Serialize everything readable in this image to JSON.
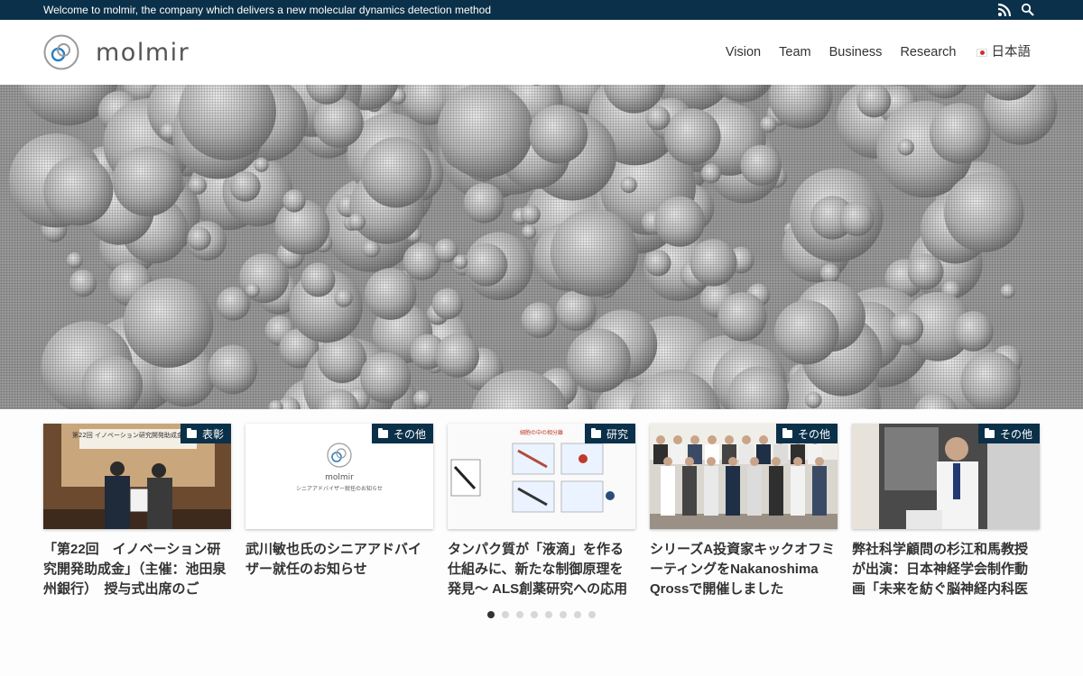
{
  "topbar": {
    "welcome": "Welcome to molmir, the company which delivers a new molecular dynamics detection method",
    "icons": [
      "rss-icon",
      "search-icon"
    ]
  },
  "header": {
    "logo_text": "molmir",
    "nav": [
      "Vision",
      "Team",
      "Business",
      "Research"
    ],
    "language": "日本語"
  },
  "colors": {
    "topbar_bg": "#0b3049",
    "category_badge": "#0b3049",
    "logo_blue": "#2a7fc4"
  },
  "cards": [
    {
      "category": "表彰",
      "title": "「第22回　イノベーション研究開発助成金」（主催：池田泉州銀行）　授与式出席のご",
      "thumb_text": "第22回 イノベーション研究開発助成金 授与式"
    },
    {
      "category": "その他",
      "title": "武川敏也氏のシニアアドバイザー就任のお知らせ",
      "thumb_logo": "molmir",
      "thumb_text": "シニアアドバイザー就任のお知らせ"
    },
    {
      "category": "研究",
      "title": "タンパク質が「液滴」を作る仕組みに、新たな制御原理を発見～ ALS創薬研究への応用",
      "thumb_text": "細胞の中の相分離"
    },
    {
      "category": "その他",
      "title": "シリーズA投資家キックオフミーティングをNakanoshima Qrossで開催しました",
      "thumb_text": ""
    },
    {
      "category": "その他",
      "title": "弊社科学顧問の杉江和馬教授が出演：日本神経学会制作動画「未来を紡ぐ脳神経内科医",
      "thumb_text": ""
    }
  ],
  "carousel": {
    "pages": 8,
    "active": 1
  }
}
